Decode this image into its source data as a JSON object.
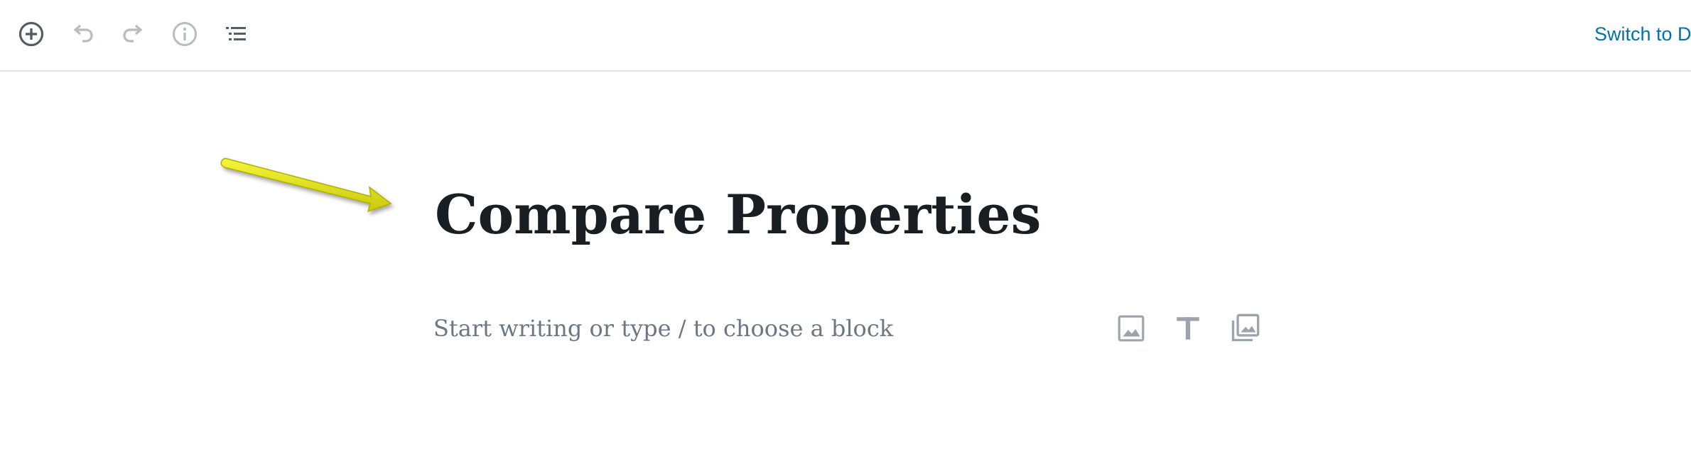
{
  "toolbar": {
    "buttons": [
      {
        "name": "add-block-button",
        "icon": "plus-circle-icon",
        "enabled": true
      },
      {
        "name": "undo-button",
        "icon": "undo-icon",
        "enabled": false
      },
      {
        "name": "redo-button",
        "icon": "redo-icon",
        "enabled": false
      },
      {
        "name": "info-button",
        "icon": "info-icon",
        "enabled": false
      },
      {
        "name": "block-navigation-button",
        "icon": "list-icon",
        "enabled": true
      }
    ],
    "switch_label": "Switch to D"
  },
  "editor": {
    "title": "Compare Properties",
    "placeholder": "Start writing or type / to choose a block",
    "inserters": [
      {
        "name": "insert-image-button",
        "icon": "image-icon"
      },
      {
        "name": "insert-heading-button",
        "icon": "heading-t-icon"
      },
      {
        "name": "insert-gallery-button",
        "icon": "gallery-icon"
      }
    ]
  },
  "annotation": {
    "icon": "yellow-arrow-icon",
    "color": "#e6e619"
  },
  "colors": {
    "link": "#0073aa",
    "title": "#191e23",
    "placeholder": "#6c7781",
    "icon_active": "#555d66",
    "icon_disabled": "#b5bcc2",
    "divider": "#e2e4e7"
  }
}
